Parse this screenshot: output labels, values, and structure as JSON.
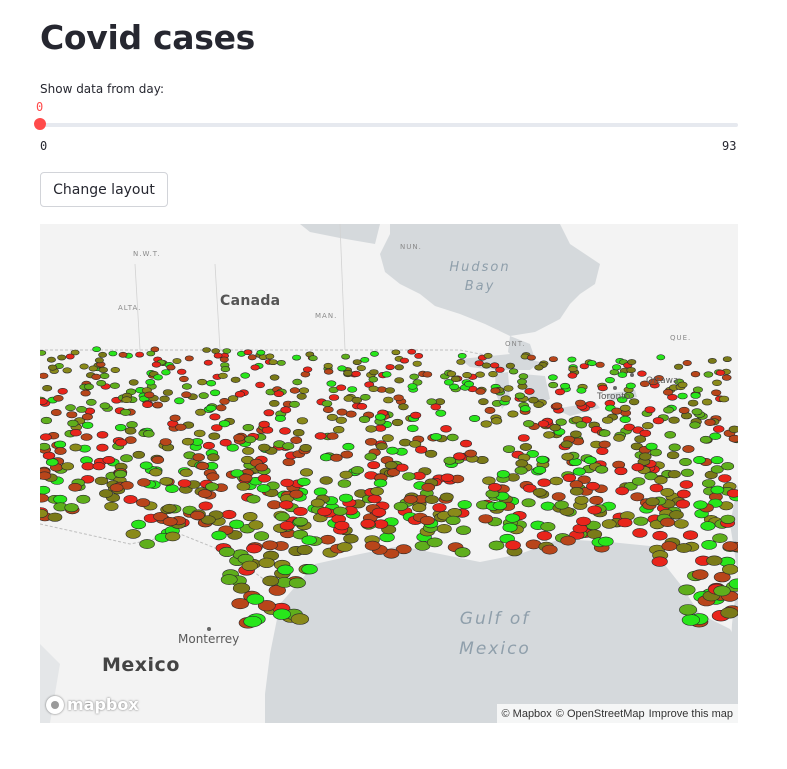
{
  "page": {
    "title": "Covid cases"
  },
  "slider": {
    "label": "Show data from day:",
    "value": "0",
    "min_label": "0",
    "max_label": "93",
    "min": 0,
    "max": 93,
    "current": 0,
    "accent_color": "#ff4b4b"
  },
  "button": {
    "label": "Change layout"
  },
  "map": {
    "labels": {
      "canada": "Canada",
      "mexico": "Mexico",
      "monterrey": "Monterrey",
      "ottawa": "Ottawa",
      "toronto": "Toronto",
      "nun": "NUN.",
      "nwt": "N.W.T.",
      "alta": "ALTA.",
      "man": "MAN.",
      "ont": "ONT.",
      "que": "QUE.",
      "hudson_bay_1": "Hudson",
      "hudson_bay_2": "Bay",
      "gulf_1": "Gulf of",
      "gulf_2": "Mexico"
    },
    "logo_text": "mapbox",
    "attribution": {
      "mapbox": "© Mapbox",
      "osm": "© OpenStreetMap",
      "improve": "Improve this map"
    },
    "colors": {
      "land": "#f3f3f3",
      "water": "#d5d9dc",
      "case_high": "#e8251b",
      "case_low": "#28e61b",
      "case_mid": "#8a8a1a"
    }
  }
}
